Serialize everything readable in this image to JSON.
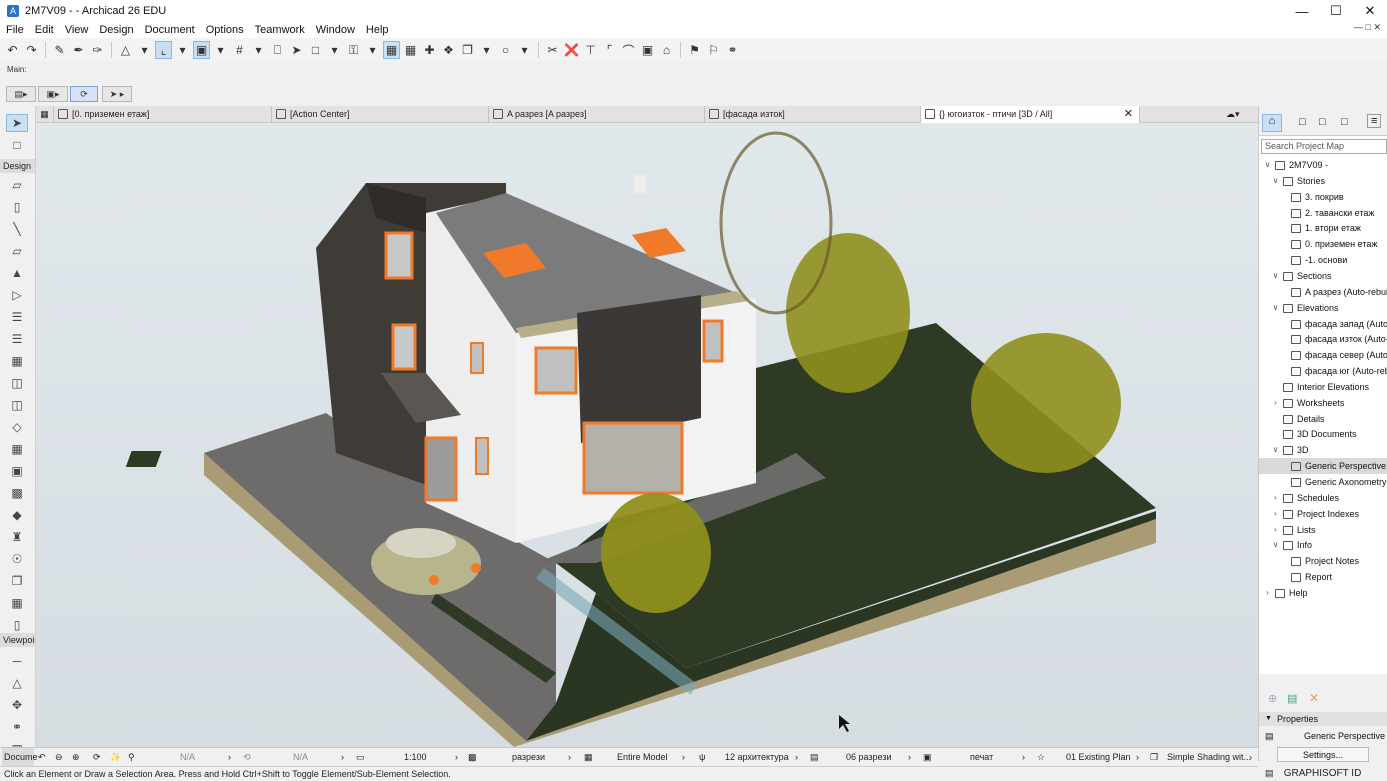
{
  "window": {
    "title": "2M7V09 - - Archicad 26 EDU",
    "icon": "archicad-icon"
  },
  "menu": [
    "File",
    "Edit",
    "View",
    "Design",
    "Document",
    "Options",
    "Teamwork",
    "Window",
    "Help"
  ],
  "infobox": {
    "label": "Main:"
  },
  "toolbox": {
    "design_label": "Design",
    "viewpoint_label": "Viewpoi",
    "document_label": "Docume"
  },
  "tabs": [
    {
      "label": "[0. приземен етаж]",
      "icon": "floor-plan-icon"
    },
    {
      "label": "[Action Center]",
      "icon": "action-center-icon"
    },
    {
      "label": "A разрез [A разрез]",
      "icon": "section-icon"
    },
    {
      "label": "[фасада изток]",
      "icon": "elevation-icon"
    },
    {
      "label": "{} югоизток - птичи [3D / All]",
      "icon": "3d-window-icon",
      "active": true
    }
  ],
  "navigator": {
    "search_placeholder": "Search Project Map",
    "tree": [
      {
        "label": "2M7V09 -",
        "level": 0,
        "caret": "open",
        "icon": "project-icon"
      },
      {
        "label": "Stories",
        "level": 1,
        "caret": "open",
        "icon": "stories-icon"
      },
      {
        "label": "3. покрив",
        "level": 2,
        "icon": "story-icon"
      },
      {
        "label": "2. тавански етаж",
        "level": 2,
        "icon": "story-icon"
      },
      {
        "label": "1. втори етаж",
        "level": 2,
        "icon": "story-icon"
      },
      {
        "label": "0. приземен етаж",
        "level": 2,
        "icon": "story-icon"
      },
      {
        "label": "-1. основи",
        "level": 2,
        "icon": "story-icon"
      },
      {
        "label": "Sections",
        "level": 1,
        "caret": "open",
        "icon": "sections-icon"
      },
      {
        "label": "A разрез (Auto-rebuild Model)",
        "level": 2,
        "icon": "section-icon"
      },
      {
        "label": "Elevations",
        "level": 1,
        "caret": "open",
        "icon": "elevations-icon"
      },
      {
        "label": "фасада запад (Auto-rebuild Model)",
        "level": 2,
        "icon": "elevation-icon"
      },
      {
        "label": "фасада изток (Auto-rebuild Model)",
        "level": 2,
        "icon": "elevation-icon"
      },
      {
        "label": "фасада север (Auto-rebuild Model)",
        "level": 2,
        "icon": "elevation-icon"
      },
      {
        "label": "фасада юг (Auto-rebuild Model)",
        "level": 2,
        "icon": "elevation-icon"
      },
      {
        "label": "Interior Elevations",
        "level": 1,
        "icon": "interior-elevations-icon"
      },
      {
        "label": "Worksheets",
        "level": 1,
        "caret": "closed",
        "icon": "worksheets-icon"
      },
      {
        "label": "Details",
        "level": 1,
        "icon": "details-icon"
      },
      {
        "label": "3D Documents",
        "level": 1,
        "icon": "3d-documents-icon"
      },
      {
        "label": "3D",
        "level": 1,
        "caret": "open",
        "icon": "3d-icon"
      },
      {
        "label": "Generic Perspective",
        "level": 2,
        "icon": "perspective-icon",
        "selected": true
      },
      {
        "label": "Generic Axonometry",
        "level": 2,
        "icon": "axonometry-icon"
      },
      {
        "label": "Schedules",
        "level": 1,
        "caret": "closed",
        "icon": "schedules-icon"
      },
      {
        "label": "Project Indexes",
        "level": 1,
        "caret": "closed",
        "icon": "project-indexes-icon"
      },
      {
        "label": "Lists",
        "level": 1,
        "caret": "closed",
        "icon": "lists-icon"
      },
      {
        "label": "Info",
        "level": 1,
        "caret": "open",
        "icon": "info-icon"
      },
      {
        "label": "Project Notes",
        "level": 2,
        "icon": "project-notes-icon"
      },
      {
        "label": "Report",
        "level": 2,
        "icon": "report-icon"
      },
      {
        "label": "Help",
        "level": 0,
        "caret": "closed",
        "icon": "help-icon"
      }
    ],
    "properties_label": "Properties",
    "properties_value": "Generic Perspective",
    "settings_button": "Settings...",
    "brand": "GRAPHISOFT ID"
  },
  "statusbar": {
    "na1": "N/A",
    "na2": "N/A",
    "scale": "1:100",
    "layer_combo": "разрези",
    "model_filter": "Entire Model",
    "pen_set": "12 архитектура",
    "mvo": "06 разрези",
    "dimension": "печат",
    "renovation": "01 Existing Plan",
    "shading": "Simple Shading wit..."
  },
  "hint": "Click an Element or Draw a Selection Area. Press and Hold Ctrl+Shift to Toggle Element/Sub-Element Selection.",
  "colors": {
    "sky": "#dde4e8",
    "terrain": "#2f3a26",
    "paving": "#6b6a6a",
    "wall_dark": "#403d39",
    "wall_white": "#e9e9e9",
    "roof": "#7a7a7a",
    "window_frame": "#f07a2a",
    "tree": "#8f8f1e",
    "base": "#b6a87e"
  }
}
